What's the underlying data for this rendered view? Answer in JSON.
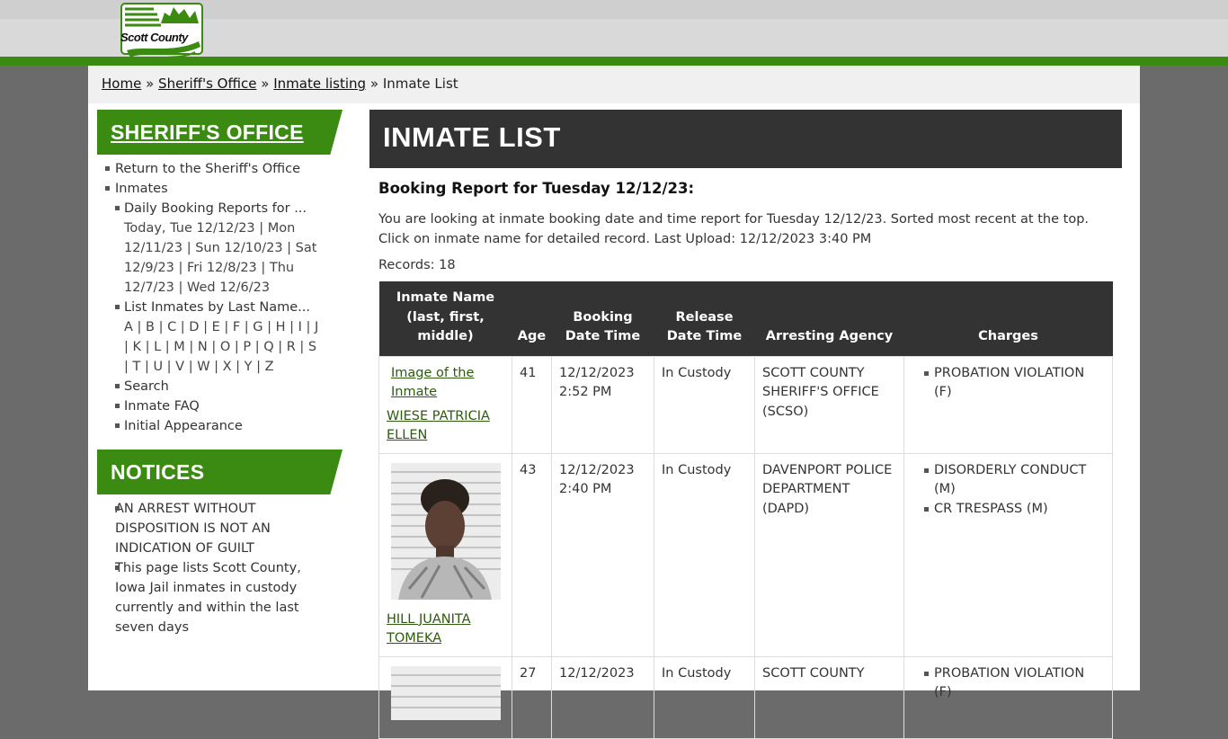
{
  "site": {
    "logo_text": "Scott County"
  },
  "breadcrumb": {
    "items": [
      "Home",
      "Sheriff's Office",
      "Inmate listing"
    ],
    "separator": "»",
    "current": "Inmate List"
  },
  "sidebar": {
    "heading": "SHERIFF'S OFFICE",
    "return_link": "Return to the Sheriff's Office",
    "inmates_label": "Inmates",
    "daily_reports_label": "Daily Booking Reports for ...",
    "daily_dates_line1": "Today, Tue 12/12/23 | Mon",
    "daily_dates_line2": "12/11/23 | Sun 12/10/23 | Sat",
    "daily_dates_line3": "12/9/23 | Fri 12/8/23 | Thu",
    "daily_dates_line4": "12/7/23 | Wed 12/6/23",
    "last_name_label": "List Inmates by Last Name...",
    "letters_line1": "A | B | C | D | E | F | G | H | I | J",
    "letters_line2": "| K | L | M | N | O | P | Q | R | S",
    "letters_line3": "| T | U | V | W | X | Y | Z",
    "search_label": "Search",
    "faq_label": "Inmate FAQ",
    "initial_appearance_label": "Initial Appearance"
  },
  "notices": {
    "heading": "NOTICES",
    "items": [
      "AN ARREST WITHOUT DISPOSITION IS NOT AN INDICATION OF GUILT",
      "This page lists Scott County, Iowa Jail inmates in custody currently and within the last seven days"
    ]
  },
  "main": {
    "title": "INMATE LIST",
    "report_title": "Booking Report for Tuesday 12/12/23:",
    "desc_line1": "You are looking at inmate booking date and time report for Tuesday 12/12/23. Sorted most recent at the top.",
    "desc_line2": "Click on inmate name for detailed record. Last Upload: 12/12/2023 3:40 PM",
    "records": "Records: 18"
  },
  "table": {
    "headers": {
      "name": "Inmate Name (last, first, middle)",
      "age": "Age",
      "booking": "Booking Date Time",
      "release": "Release Date Time",
      "agency": "Arresting Agency",
      "charges": "Charges"
    },
    "image_alt": "Image of the Inmate",
    "rows": [
      {
        "name": "WIESE PATRICIA ELLEN",
        "age": "41",
        "booking_date": "12/12/2023",
        "booking_time": "2:52 PM",
        "release": "In Custody",
        "agency": "SCOTT COUNTY SHERIFF'S OFFICE (SCSO)",
        "charges": [
          "PROBATION VIOLATION (F)"
        ]
      },
      {
        "name": "HILL JUANITA TOMEKA",
        "age": "43",
        "booking_date": "12/12/2023",
        "booking_time": "2:40 PM",
        "release": "In Custody",
        "agency": "DAVENPORT POLICE DEPARTMENT (DAPD)",
        "charges": [
          "DISORDERLY CONDUCT (M)",
          "CR TRESPASS (M)"
        ]
      },
      {
        "name": "",
        "age": "27",
        "booking_date": "12/12/2023",
        "booking_time": "",
        "release": "In Custody",
        "agency": "SCOTT COUNTY",
        "charges": [
          "PROBATION VIOLATION (F)"
        ]
      }
    ]
  },
  "colors": {
    "brand_green": "#3b8a12",
    "dark_header": "#333333",
    "link_green": "#2d5a0e"
  }
}
